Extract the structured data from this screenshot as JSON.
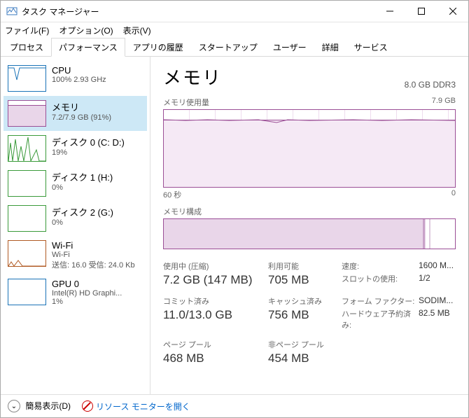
{
  "window": {
    "title": "タスク マネージャー"
  },
  "menu": {
    "file": "ファイル(F)",
    "options": "オプション(O)",
    "view": "表示(V)"
  },
  "tabs": {
    "processes": "プロセス",
    "performance": "パフォーマンス",
    "app_history": "アプリの履歴",
    "startup": "スタートアップ",
    "users": "ユーザー",
    "details": "詳細",
    "services": "サービス"
  },
  "sidebar": {
    "cpu": {
      "name": "CPU",
      "sub": "100%  2.93 GHz"
    },
    "mem": {
      "name": "メモリ",
      "sub": "7.2/7.9 GB (91%)"
    },
    "disk0": {
      "name": "ディスク 0 (C: D:)",
      "sub": "19%"
    },
    "disk1": {
      "name": "ディスク 1 (H:)",
      "sub": "0%"
    },
    "disk2": {
      "name": "ディスク 2 (G:)",
      "sub": "0%"
    },
    "wifi": {
      "name": "Wi-Fi",
      "sub": "Wi-Fi",
      "sub2": "送信: 16.0 受信: 24.0 Kb"
    },
    "gpu": {
      "name": "GPU 0",
      "sub": "Intel(R) HD Graphi...",
      "sub2": "1%"
    }
  },
  "main": {
    "title": "メモリ",
    "spec": "8.0 GB DDR3",
    "usage_label": "メモリ使用量",
    "usage_max": "7.9 GB",
    "axis_left": "60 秒",
    "axis_right": "0",
    "comp_label": "メモリ構成",
    "stats": {
      "in_use_label": "使用中 (圧縮)",
      "in_use": "7.2 GB (147 MB)",
      "avail_label": "利用可能",
      "avail": "705 MB",
      "commit_label": "コミット済み",
      "commit": "11.0/13.0 GB",
      "cached_label": "キャッシュ済み",
      "cached": "756 MB",
      "paged_label": "ページ プール",
      "paged": "468 MB",
      "nonpaged_label": "非ページ プール",
      "nonpaged": "454 MB",
      "speed_label": "速度:",
      "speed": "1600 M...",
      "slots_label": "スロットの使用:",
      "slots": "1/2",
      "form_label": "フォーム ファクター:",
      "form": "SODIM...",
      "hw_label": "ハードウェア予約済み:",
      "hw": "82.5 MB"
    }
  },
  "status": {
    "fewer": "簡易表示(D)",
    "resmon": "リソース モニターを開く"
  },
  "chart_data": {
    "type": "line",
    "title": "メモリ使用量",
    "xlabel": "秒",
    "ylabel": "GB",
    "xlim": [
      0,
      60
    ],
    "ylim": [
      0,
      7.9
    ],
    "x": [
      60,
      55,
      50,
      45,
      40,
      35,
      30,
      25,
      20,
      15,
      10,
      5,
      0
    ],
    "values": [
      7.0,
      7.0,
      6.9,
      7.0,
      6.9,
      6.8,
      7.0,
      6.9,
      7.0,
      6.9,
      7.0,
      6.9,
      7.0
    ]
  }
}
